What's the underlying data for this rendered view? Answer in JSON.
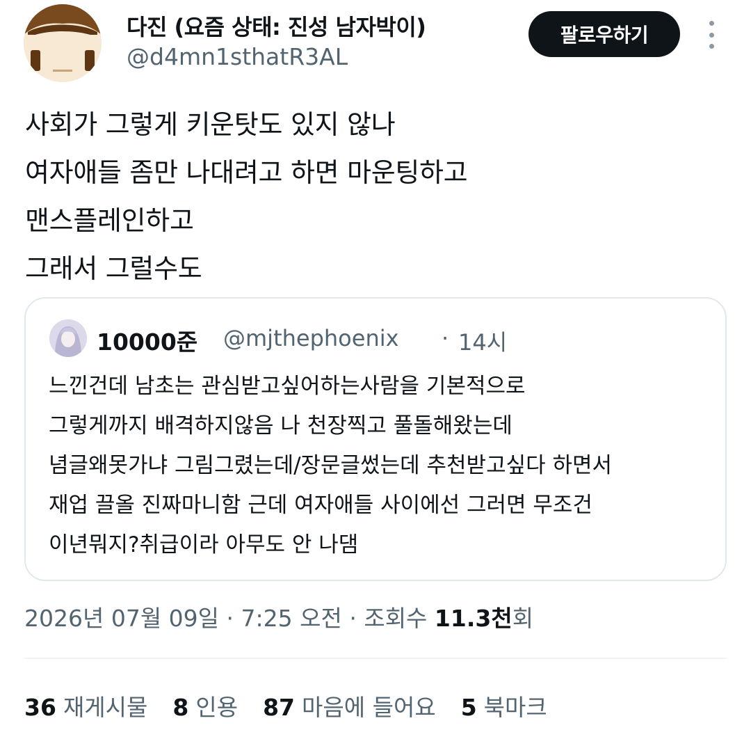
{
  "author": {
    "display_name": "다진 (요즘 상태: 진성 남자박이)",
    "handle": "@d4mn1sthatR3AL",
    "avatar_icon": "cartoon-face-avatar"
  },
  "header": {
    "follow_label": "팔로우하기",
    "more_icon": "vertical-ellipsis-icon"
  },
  "tweet": {
    "lines": [
      "사회가 그렇게 키운탓도 있지 않나",
      "여자애들 좀만 나대려고 하면 마운팅하고",
      "맨스플레인하고",
      "그래서 그럴수도"
    ]
  },
  "quote": {
    "name": "10000준",
    "handle": "@mjthephoenix",
    "separator": "·",
    "time": "14시",
    "lines": [
      "느낀건데 남초는 관심받고싶어하는사람을 기본적으로",
      "그렇게까지 배격하지않음 나 천장찍고 풀돌해왔는데",
      "념글왜못가냐 그림그렸는데/장문글썼는데 추천받고싶다 하면서",
      "재업 끌올 진짜마니함 근데 여자애들 사이에선 그러면 무조건",
      "이년뭐지?취급이라 아무도 안 나댐"
    ]
  },
  "meta": {
    "date": "2026년 07월 09일",
    "sep1": " · ",
    "time": "7:25 오전",
    "sep2": " · ",
    "views_label": "조회수 ",
    "views_count": "11.3천",
    "views_suffix": "회"
  },
  "stats": [
    {
      "count": "36",
      "label": "재게시물"
    },
    {
      "count": "8",
      "label": "인용"
    },
    {
      "count": "87",
      "label": "마음에 들어요"
    },
    {
      "count": "5",
      "label": "북마크"
    }
  ],
  "colors": {
    "text_primary": "#0f1419",
    "text_secondary": "#536471",
    "border": "#e1e8ed",
    "button_bg": "#0f1419"
  }
}
